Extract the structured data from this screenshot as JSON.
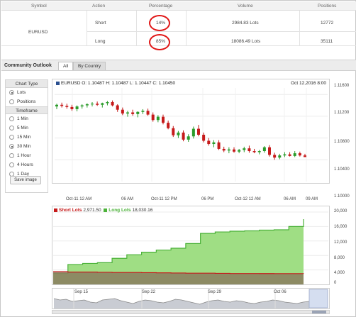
{
  "summary": {
    "headers": {
      "symbol": "Symbol",
      "action": "Action",
      "percentage": "Percentage",
      "volume": "Volume",
      "positions": "Positions"
    },
    "symbol": "EURUSD",
    "rows": [
      {
        "action": "Short",
        "percentage": "14%",
        "volume": "2984.83 Lots",
        "positions": "12772"
      },
      {
        "action": "Long",
        "percentage": "85%",
        "volume": "18086.49 Lots",
        "positions": "35111"
      }
    ]
  },
  "section": {
    "title": "Community Outlook",
    "tabs": [
      {
        "label": "All",
        "active": true
      },
      {
        "label": "By Country",
        "active": false
      }
    ]
  },
  "left_panel": {
    "chart_type_title": "Chart Type",
    "chart_type_options": [
      {
        "label": "Lots",
        "selected": true
      },
      {
        "label": "Positions",
        "selected": false
      }
    ],
    "timeframe_title": "Timeframe",
    "timeframe_options": [
      {
        "label": "1 Min",
        "selected": false
      },
      {
        "label": "5 Min",
        "selected": false
      },
      {
        "label": "15 Min",
        "selected": false
      },
      {
        "label": "30 Min",
        "selected": true
      },
      {
        "label": "1 Hour",
        "selected": false
      },
      {
        "label": "4 Hours",
        "selected": false
      },
      {
        "label": "1 Day",
        "selected": false
      }
    ],
    "save_button": "Save image"
  },
  "price_panel": {
    "ohlc_text": "EURUSD O: 1.10487 H: 1.10487 L: 1.10447 C: 1.10450",
    "date_text": "Oct 12,2016 8:00"
  },
  "volume_panel": {
    "short_label": "Short Lots",
    "short_value": "2,971.50",
    "long_label": "Long Lots",
    "long_value": "18,030.16"
  },
  "navigator": {
    "labels": [
      "Sep 15",
      "Sep 22",
      "Sep 29",
      "Oct 06"
    ]
  },
  "colors": {
    "up": "#2a9b2a",
    "down": "#c61a1a",
    "long_fill": "#9fde84",
    "long_line": "#4cb23a",
    "short_fill": "#8a7d5e",
    "short_line": "#c61a1a",
    "highlight_circle": "#e01616"
  },
  "chart_data": [
    {
      "type": "candlestick",
      "title": "EURUSD",
      "x_tick_labels": [
        "Oct-11 12 AM",
        "06 AM",
        "Oct-11 12 PM",
        "06 PM",
        "Oct-12 12 AM",
        "06 AM",
        "09 AM"
      ],
      "y_tick_labels": [
        "1.11600",
        "1.11200",
        "1.10800",
        "1.10400",
        "1.10000"
      ],
      "ylim": [
        1.1,
        1.1172
      ],
      "grid": true,
      "candles": [
        {
          "o": 1.1138,
          "h": 1.1143,
          "l": 1.1133,
          "c": 1.1141
        },
        {
          "o": 1.1141,
          "h": 1.1145,
          "l": 1.1136,
          "c": 1.1139
        },
        {
          "o": 1.1139,
          "h": 1.1143,
          "l": 1.1134,
          "c": 1.1137
        },
        {
          "o": 1.1137,
          "h": 1.1141,
          "l": 1.113,
          "c": 1.1133
        },
        {
          "o": 1.1133,
          "h": 1.114,
          "l": 1.1129,
          "c": 1.1138
        },
        {
          "o": 1.1138,
          "h": 1.1142,
          "l": 1.1134,
          "c": 1.114
        },
        {
          "o": 1.114,
          "h": 1.1144,
          "l": 1.1136,
          "c": 1.1142
        },
        {
          "o": 1.1142,
          "h": 1.1146,
          "l": 1.1138,
          "c": 1.1143
        },
        {
          "o": 1.1143,
          "h": 1.1147,
          "l": 1.1139,
          "c": 1.1141
        },
        {
          "o": 1.1141,
          "h": 1.1145,
          "l": 1.1136,
          "c": 1.1144
        },
        {
          "o": 1.1144,
          "h": 1.1148,
          "l": 1.114,
          "c": 1.1146
        },
        {
          "o": 1.1146,
          "h": 1.1149,
          "l": 1.1138,
          "c": 1.114
        },
        {
          "o": 1.114,
          "h": 1.1142,
          "l": 1.1128,
          "c": 1.1132
        },
        {
          "o": 1.1132,
          "h": 1.1136,
          "l": 1.1122,
          "c": 1.1125
        },
        {
          "o": 1.1125,
          "h": 1.113,
          "l": 1.1119,
          "c": 1.1127
        },
        {
          "o": 1.1127,
          "h": 1.1132,
          "l": 1.1121,
          "c": 1.1124
        },
        {
          "o": 1.1124,
          "h": 1.1129,
          "l": 1.1118,
          "c": 1.1128
        },
        {
          "o": 1.1128,
          "h": 1.1133,
          "l": 1.1124,
          "c": 1.113
        },
        {
          "o": 1.113,
          "h": 1.1134,
          "l": 1.1121,
          "c": 1.1123
        },
        {
          "o": 1.1123,
          "h": 1.1127,
          "l": 1.111,
          "c": 1.1113
        },
        {
          "o": 1.1113,
          "h": 1.1122,
          "l": 1.1109,
          "c": 1.1119
        },
        {
          "o": 1.1119,
          "h": 1.1123,
          "l": 1.1105,
          "c": 1.1108
        },
        {
          "o": 1.1108,
          "h": 1.1112,
          "l": 1.1096,
          "c": 1.1098
        },
        {
          "o": 1.1098,
          "h": 1.1102,
          "l": 1.1082,
          "c": 1.1085
        },
        {
          "o": 1.1085,
          "h": 1.1093,
          "l": 1.108,
          "c": 1.109
        },
        {
          "o": 1.109,
          "h": 1.1094,
          "l": 1.1074,
          "c": 1.1077
        },
        {
          "o": 1.1077,
          "h": 1.1087,
          "l": 1.1073,
          "c": 1.1083
        },
        {
          "o": 1.1083,
          "h": 1.1101,
          "l": 1.1079,
          "c": 1.1097
        },
        {
          "o": 1.1097,
          "h": 1.1104,
          "l": 1.1083,
          "c": 1.1086
        },
        {
          "o": 1.1086,
          "h": 1.109,
          "l": 1.1072,
          "c": 1.1075
        },
        {
          "o": 1.1075,
          "h": 1.108,
          "l": 1.1066,
          "c": 1.1069
        },
        {
          "o": 1.1069,
          "h": 1.1076,
          "l": 1.1063,
          "c": 1.1072
        },
        {
          "o": 1.1072,
          "h": 1.1076,
          "l": 1.1058,
          "c": 1.106
        },
        {
          "o": 1.106,
          "h": 1.1064,
          "l": 1.1054,
          "c": 1.1057
        },
        {
          "o": 1.1057,
          "h": 1.1063,
          "l": 1.1052,
          "c": 1.1059
        },
        {
          "o": 1.1059,
          "h": 1.1063,
          "l": 1.1053,
          "c": 1.1055
        },
        {
          "o": 1.1055,
          "h": 1.106,
          "l": 1.1052,
          "c": 1.1058
        },
        {
          "o": 1.1058,
          "h": 1.1064,
          "l": 1.1054,
          "c": 1.1061
        },
        {
          "o": 1.1061,
          "h": 1.1066,
          "l": 1.1053,
          "c": 1.1056
        },
        {
          "o": 1.1056,
          "h": 1.106,
          "l": 1.1052,
          "c": 1.1054
        },
        {
          "o": 1.1054,
          "h": 1.1058,
          "l": 1.105,
          "c": 1.1056
        },
        {
          "o": 1.1056,
          "h": 1.1065,
          "l": 1.1053,
          "c": 1.1063
        },
        {
          "o": 1.1063,
          "h": 1.1067,
          "l": 1.1046,
          "c": 1.1049
        },
        {
          "o": 1.1049,
          "h": 1.1053,
          "l": 1.104,
          "c": 1.1044
        },
        {
          "o": 1.1044,
          "h": 1.1051,
          "l": 1.1041,
          "c": 1.1048
        },
        {
          "o": 1.1048,
          "h": 1.1054,
          "l": 1.1045,
          "c": 1.105
        },
        {
          "o": 1.105,
          "h": 1.1054,
          "l": 1.1046,
          "c": 1.1047
        },
        {
          "o": 1.1047,
          "h": 1.1056,
          "l": 1.1045,
          "c": 1.1052
        },
        {
          "o": 1.1052,
          "h": 1.1055,
          "l": 1.1046,
          "c": 1.1048
        },
        {
          "o": 1.1048,
          "h": 1.1051,
          "l": 1.1045,
          "c": 1.1045
        }
      ]
    },
    {
      "type": "area",
      "series": [
        {
          "name": "Short Lots",
          "values": [
            3500,
            3400,
            3400,
            3350,
            3300,
            3300,
            3250,
            3200,
            3150,
            3100,
            3100,
            3050,
            3000,
            3000,
            2990,
            2980,
            2975,
            2972
          ]
        },
        {
          "name": "Long Lots",
          "values": [
            3000,
            5500,
            5800,
            6000,
            7200,
            8200,
            8900,
            9500,
            10000,
            11300,
            14100,
            14500,
            14700,
            14800,
            15000,
            15100,
            16000,
            18030
          ]
        }
      ],
      "y_tick_labels": [
        "20,000",
        "16,000",
        "12,000",
        "8,000",
        "4,000",
        "0"
      ],
      "ylim": [
        0,
        20000
      ],
      "legend": "top-left",
      "grid": true
    }
  ]
}
